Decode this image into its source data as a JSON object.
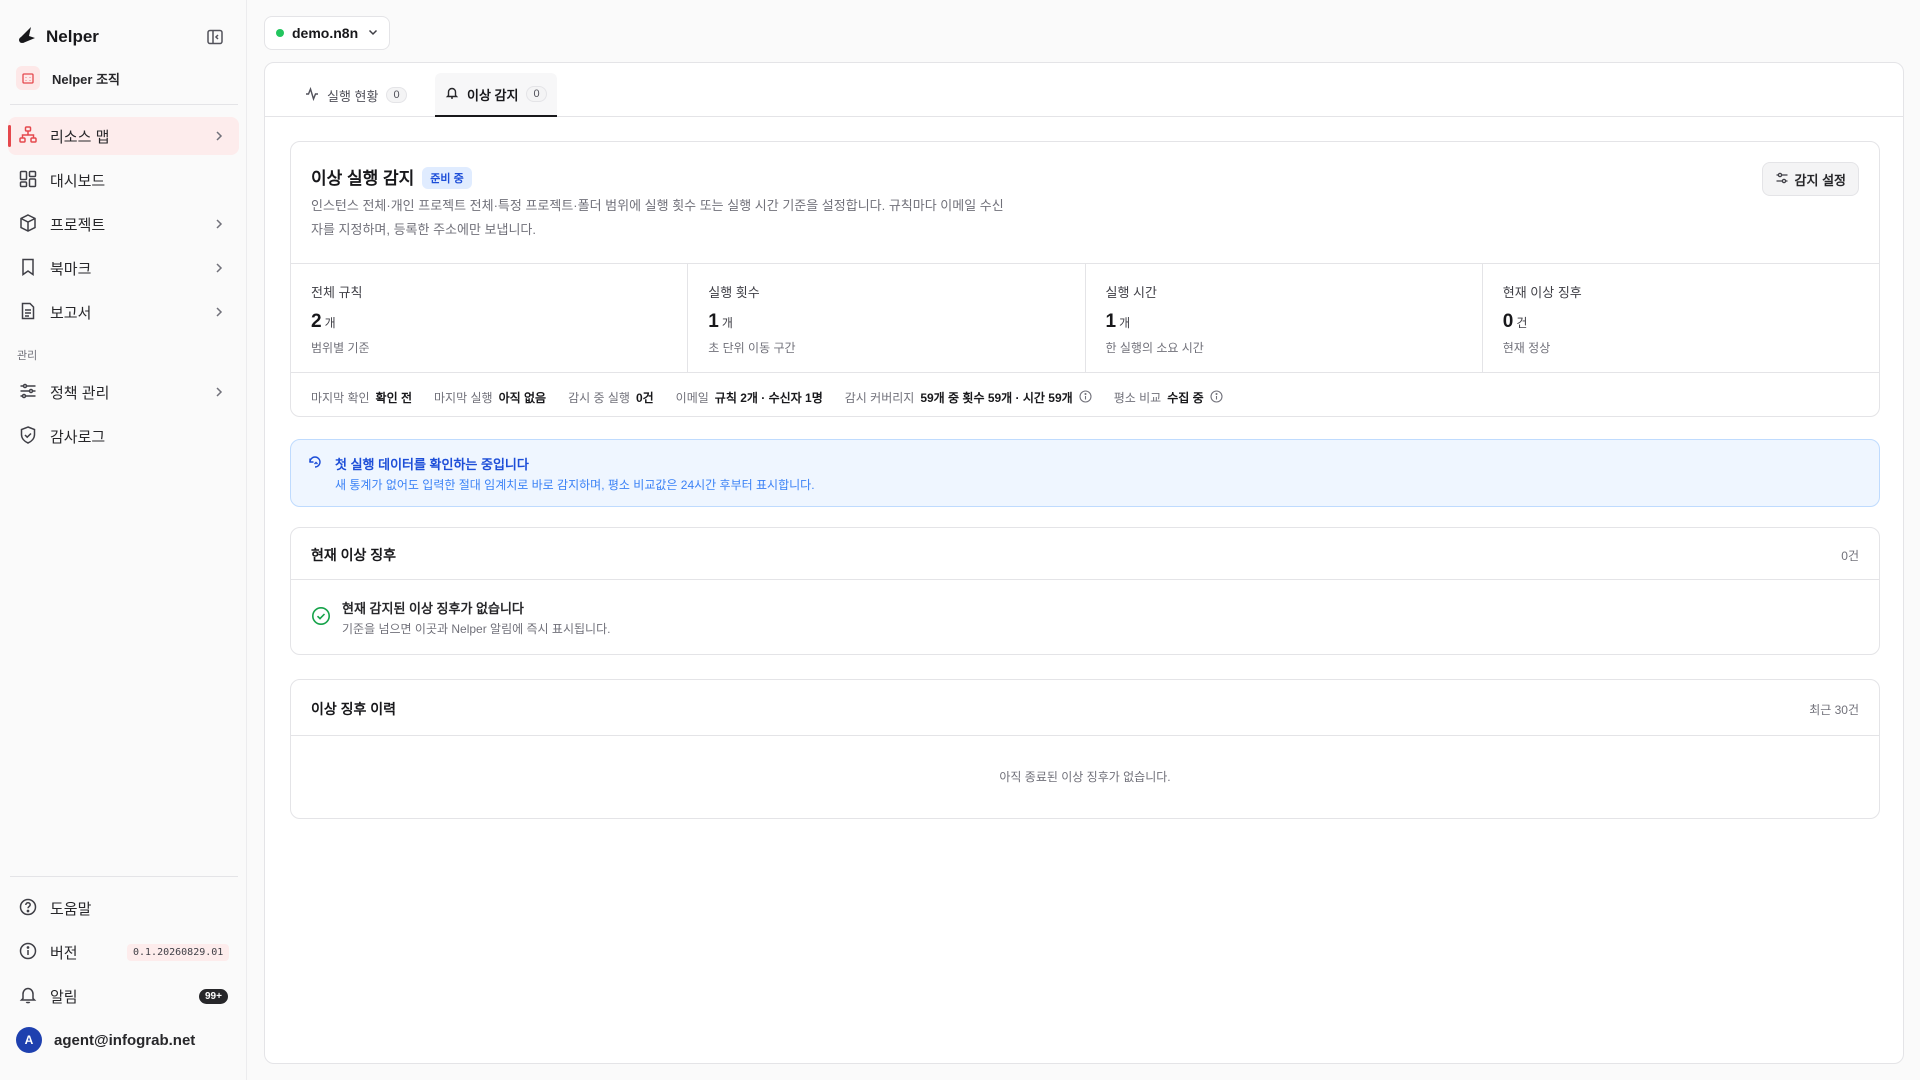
{
  "app": {
    "name": "Nelper",
    "org_name": "Nelper 조직"
  },
  "sidebar": {
    "items": [
      {
        "label": "리소스 맵",
        "icon": "sitemap-icon",
        "active": true
      },
      {
        "label": "대시보드",
        "icon": "dashboard-icon"
      },
      {
        "label": "프로젝트",
        "icon": "box-icon"
      },
      {
        "label": "북마크",
        "icon": "bookmark-icon"
      },
      {
        "label": "보고서",
        "icon": "document-icon"
      }
    ],
    "section_label": "관리",
    "admin_items": [
      {
        "label": "정책 관리",
        "icon": "sliders-icon"
      },
      {
        "label": "감사로그",
        "icon": "shield-check-icon"
      }
    ],
    "footer": {
      "help": "도움말",
      "version_label": "버전",
      "version_value": "0.1.20260829.01",
      "notifications": "알림",
      "notif_count": "99+",
      "user_initial": "A",
      "user_email": "agent@infograb.net"
    }
  },
  "env": {
    "label": "demo.n8n",
    "status_color": "#22c55e"
  },
  "tabs": [
    {
      "label": "실행 현황",
      "count": "0",
      "active": false
    },
    {
      "label": "이상 감지",
      "count": "0",
      "active": true
    }
  ],
  "detector": {
    "title": "이상 실행 감지",
    "status": "준비 중",
    "description": "인스턴스 전체·개인 프로젝트 전체·특정 프로젝트·폴더 범위에 실행 횟수 또는 실행 시간 기준을 설정합니다. 규칙마다 이메일 수신자를 지정하며, 등록한 주소에만 보냅니다.",
    "settings_label": "감지 설정",
    "stats": [
      {
        "label": "전체 규칙",
        "value": "2",
        "unit": "개",
        "sub": "범위별 기준"
      },
      {
        "label": "실행 횟수",
        "value": "1",
        "unit": "개",
        "sub": "초 단위 이동 구간"
      },
      {
        "label": "실행 시간",
        "value": "1",
        "unit": "개",
        "sub": "한 실행의 소요 시간"
      },
      {
        "label": "현재 이상 징후",
        "value": "0",
        "unit": "건",
        "sub": "현재 정상"
      }
    ],
    "meta": [
      {
        "k": "마지막 확인",
        "v": "확인 전"
      },
      {
        "k": "마지막 실행",
        "v": "아직 없음"
      },
      {
        "k": "감시 중 실행",
        "v": "0건"
      },
      {
        "k": "이메일",
        "v": "규칙 2개 · 수신자 1명"
      },
      {
        "k": "감시 커버리지",
        "v": "59개 중 횟수 59개 · 시간 59개"
      },
      {
        "k": "평소 비교",
        "v": "수집 중"
      }
    ]
  },
  "banner": {
    "title": "첫 실행 데이터를 확인하는 중입니다",
    "desc": "새 통계가 없어도 입력한 절대 임계치로 바로 감지하며, 평소 비교값은 24시간 후부터 표시합니다."
  },
  "current": {
    "title": "현재 이상 징후",
    "count": "0건",
    "empty_title": "현재 감지된 이상 징후가 없습니다",
    "empty_desc": "기준을 넘으면 이곳과 Nelper 알림에 즉시 표시됩니다."
  },
  "history": {
    "title": "이상 징후 이력",
    "range": "최근 30건",
    "empty": "아직 종료된 이상 징후가 없습니다."
  }
}
